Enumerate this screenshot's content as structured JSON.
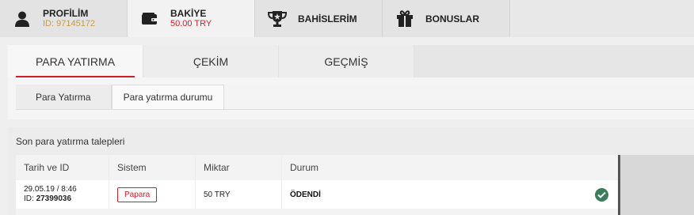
{
  "top_tabs": [
    {
      "title": "PROFİLİM",
      "sub": "ID: 97145172",
      "icon": "user-icon"
    },
    {
      "title": "BAKİYE",
      "sub": "50.00 TRY",
      "icon": "wallet-icon"
    },
    {
      "title": "BAHİSLERİM",
      "icon": "trophy-icon"
    },
    {
      "title": "BONUSLAR",
      "icon": "gift-icon"
    }
  ],
  "sub_tabs": [
    "PARA YATIRMA",
    "ÇEKİM",
    "GEÇMİŞ"
  ],
  "inner_tabs": [
    "Para Yatırma",
    "Para yatırma durumu"
  ],
  "requests": {
    "title": "Son para yatırma talepleri",
    "headers": [
      "Tarih ve ID",
      "Sistem",
      "Miktar",
      "Durum"
    ],
    "rows": [
      {
        "date": "29.05.19 / 8:46",
        "id_label": "ID:",
        "id": "27399036",
        "system": "Papara",
        "amount": "50 TRY",
        "status": "ÖDENDİ"
      }
    ]
  },
  "colors": {
    "accent": "#d11f2a",
    "gold": "#c59b4a",
    "success": "#3c7d5a"
  }
}
